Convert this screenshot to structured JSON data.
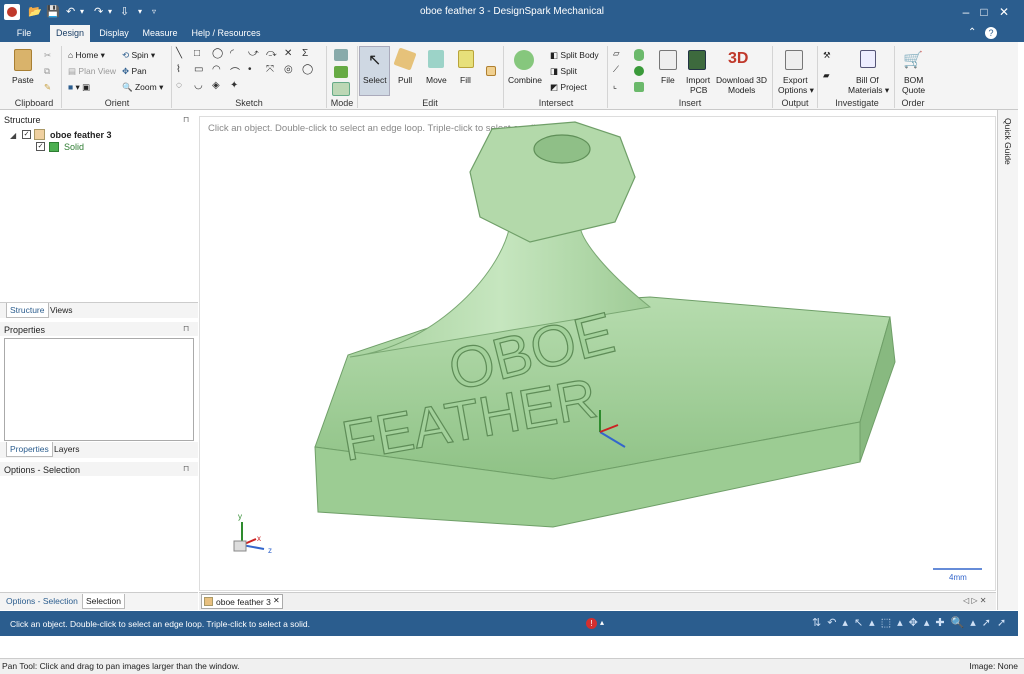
{
  "window": {
    "title": "oboe feather 3 - DesignSpark Mechanical",
    "min_btn": "–",
    "max_btn": "□",
    "close_btn": "✕"
  },
  "tabs": [
    {
      "label": "File"
    },
    {
      "label": "Design"
    },
    {
      "label": "Display"
    },
    {
      "label": "Measure"
    },
    {
      "label": "Help / Resources"
    }
  ],
  "ribbon": {
    "clipboard": {
      "paste": "Paste",
      "group": "Clipboard"
    },
    "orient": {
      "home": "Home",
      "plan_view": "Plan View",
      "spin": "Spin",
      "pan": "Pan",
      "zoom": "Zoom",
      "group": "Orient"
    },
    "sketch": {
      "group": "Sketch"
    },
    "mode": {
      "group": "Mode"
    },
    "edit": {
      "select": "Select",
      "pull": "Pull",
      "move": "Move",
      "fill": "Fill",
      "group": "Edit"
    },
    "intersect": {
      "combine": "Combine",
      "split_body": "Split Body",
      "split": "Split",
      "project": "Project",
      "group": "Intersect"
    },
    "insert": {
      "file": "File",
      "import_pcb": "Import",
      "import_pcb2": "PCB",
      "download": "Download 3D",
      "download2": "Models",
      "group": "Insert",
      "logo3d": "3D"
    },
    "output": {
      "export": "Export",
      "export2": "Options",
      "group": "Output"
    },
    "investigate": {
      "bom": "Bill Of",
      "bom2": "Materials",
      "group": "Investigate"
    },
    "order": {
      "quote": "BOM",
      "quote2": "Quote",
      "group": "Order"
    }
  },
  "structure": {
    "title": "Structure",
    "root": "oboe feather 3",
    "child": "Solid",
    "tab_structure": "Structure",
    "tab_views": "Views"
  },
  "properties": {
    "title": "Properties",
    "tab_properties": "Properties",
    "tab_layers": "Layers"
  },
  "options": {
    "title": "Options - Selection",
    "tab_options": "Options - Selection",
    "tab_selection": "Selection"
  },
  "viewport": {
    "hint": "Click an object. Double-click to select an edge loop. Triple-click to select a solid.",
    "model_text1": "OBOE",
    "model_text2": "FEATHER",
    "scale": "4mm",
    "doc_tab": "oboe feather 3",
    "axis_x": "x",
    "axis_y": "y",
    "axis_z": "z",
    "quick_guide": "Quick Guide"
  },
  "status": {
    "message": "Click an object. Double-click to select an edge loop. Triple-click to select a solid.",
    "bottom_left": "Pan Tool: Click and drag to pan images larger than the window.",
    "bottom_right": "Image: None"
  },
  "colors": {
    "accent": "#2b5d8e",
    "model": "#a8d3a0",
    "model_dark": "#7fb27a"
  }
}
